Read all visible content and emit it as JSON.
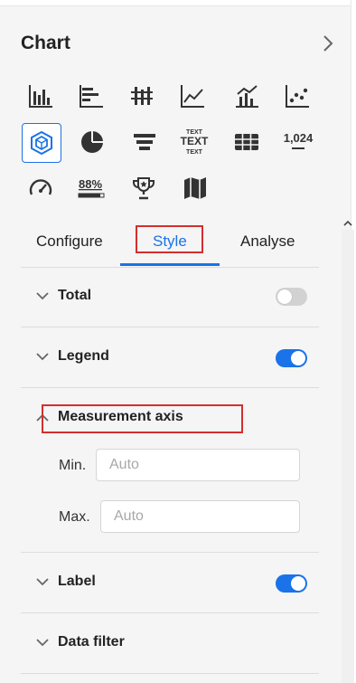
{
  "panel": {
    "title": "Chart"
  },
  "chart_types": [
    {
      "name": "bar-chart-icon"
    },
    {
      "name": "horizontal-bar-chart-icon"
    },
    {
      "name": "stacked-bar-chart-icon"
    },
    {
      "name": "line-chart-icon"
    },
    {
      "name": "combo-chart-icon"
    },
    {
      "name": "scatter-chart-icon"
    },
    {
      "name": "cube-chart-icon",
      "selected": true
    },
    {
      "name": "pie-chart-icon"
    },
    {
      "name": "funnel-chart-icon"
    },
    {
      "name": "word-cloud-icon",
      "glyph": "TEXT"
    },
    {
      "name": "table-icon"
    },
    {
      "name": "kpi-number-icon",
      "glyph": "1,024"
    },
    {
      "name": "gauge-icon"
    },
    {
      "name": "progress-icon",
      "glyph": "88%"
    },
    {
      "name": "trophy-icon"
    },
    {
      "name": "map-icon"
    }
  ],
  "tabs": [
    "Configure",
    "Style",
    "Analyse"
  ],
  "active_tab": "Style",
  "sections": {
    "total": {
      "label": "Total",
      "enabled": false
    },
    "legend": {
      "label": "Legend",
      "enabled": true
    },
    "measurement_axis": {
      "label": "Measurement axis",
      "expanded": true,
      "min_label": "Min.",
      "max_label": "Max.",
      "min_placeholder": "Auto",
      "max_placeholder": "Auto"
    },
    "label": {
      "label": "Label",
      "enabled": true
    },
    "data_filter": {
      "label": "Data filter"
    }
  },
  "colors": {
    "accent": "#1a73e8",
    "highlight_border": "#d32f2f",
    "toggle_off": "#d2d2d2"
  }
}
